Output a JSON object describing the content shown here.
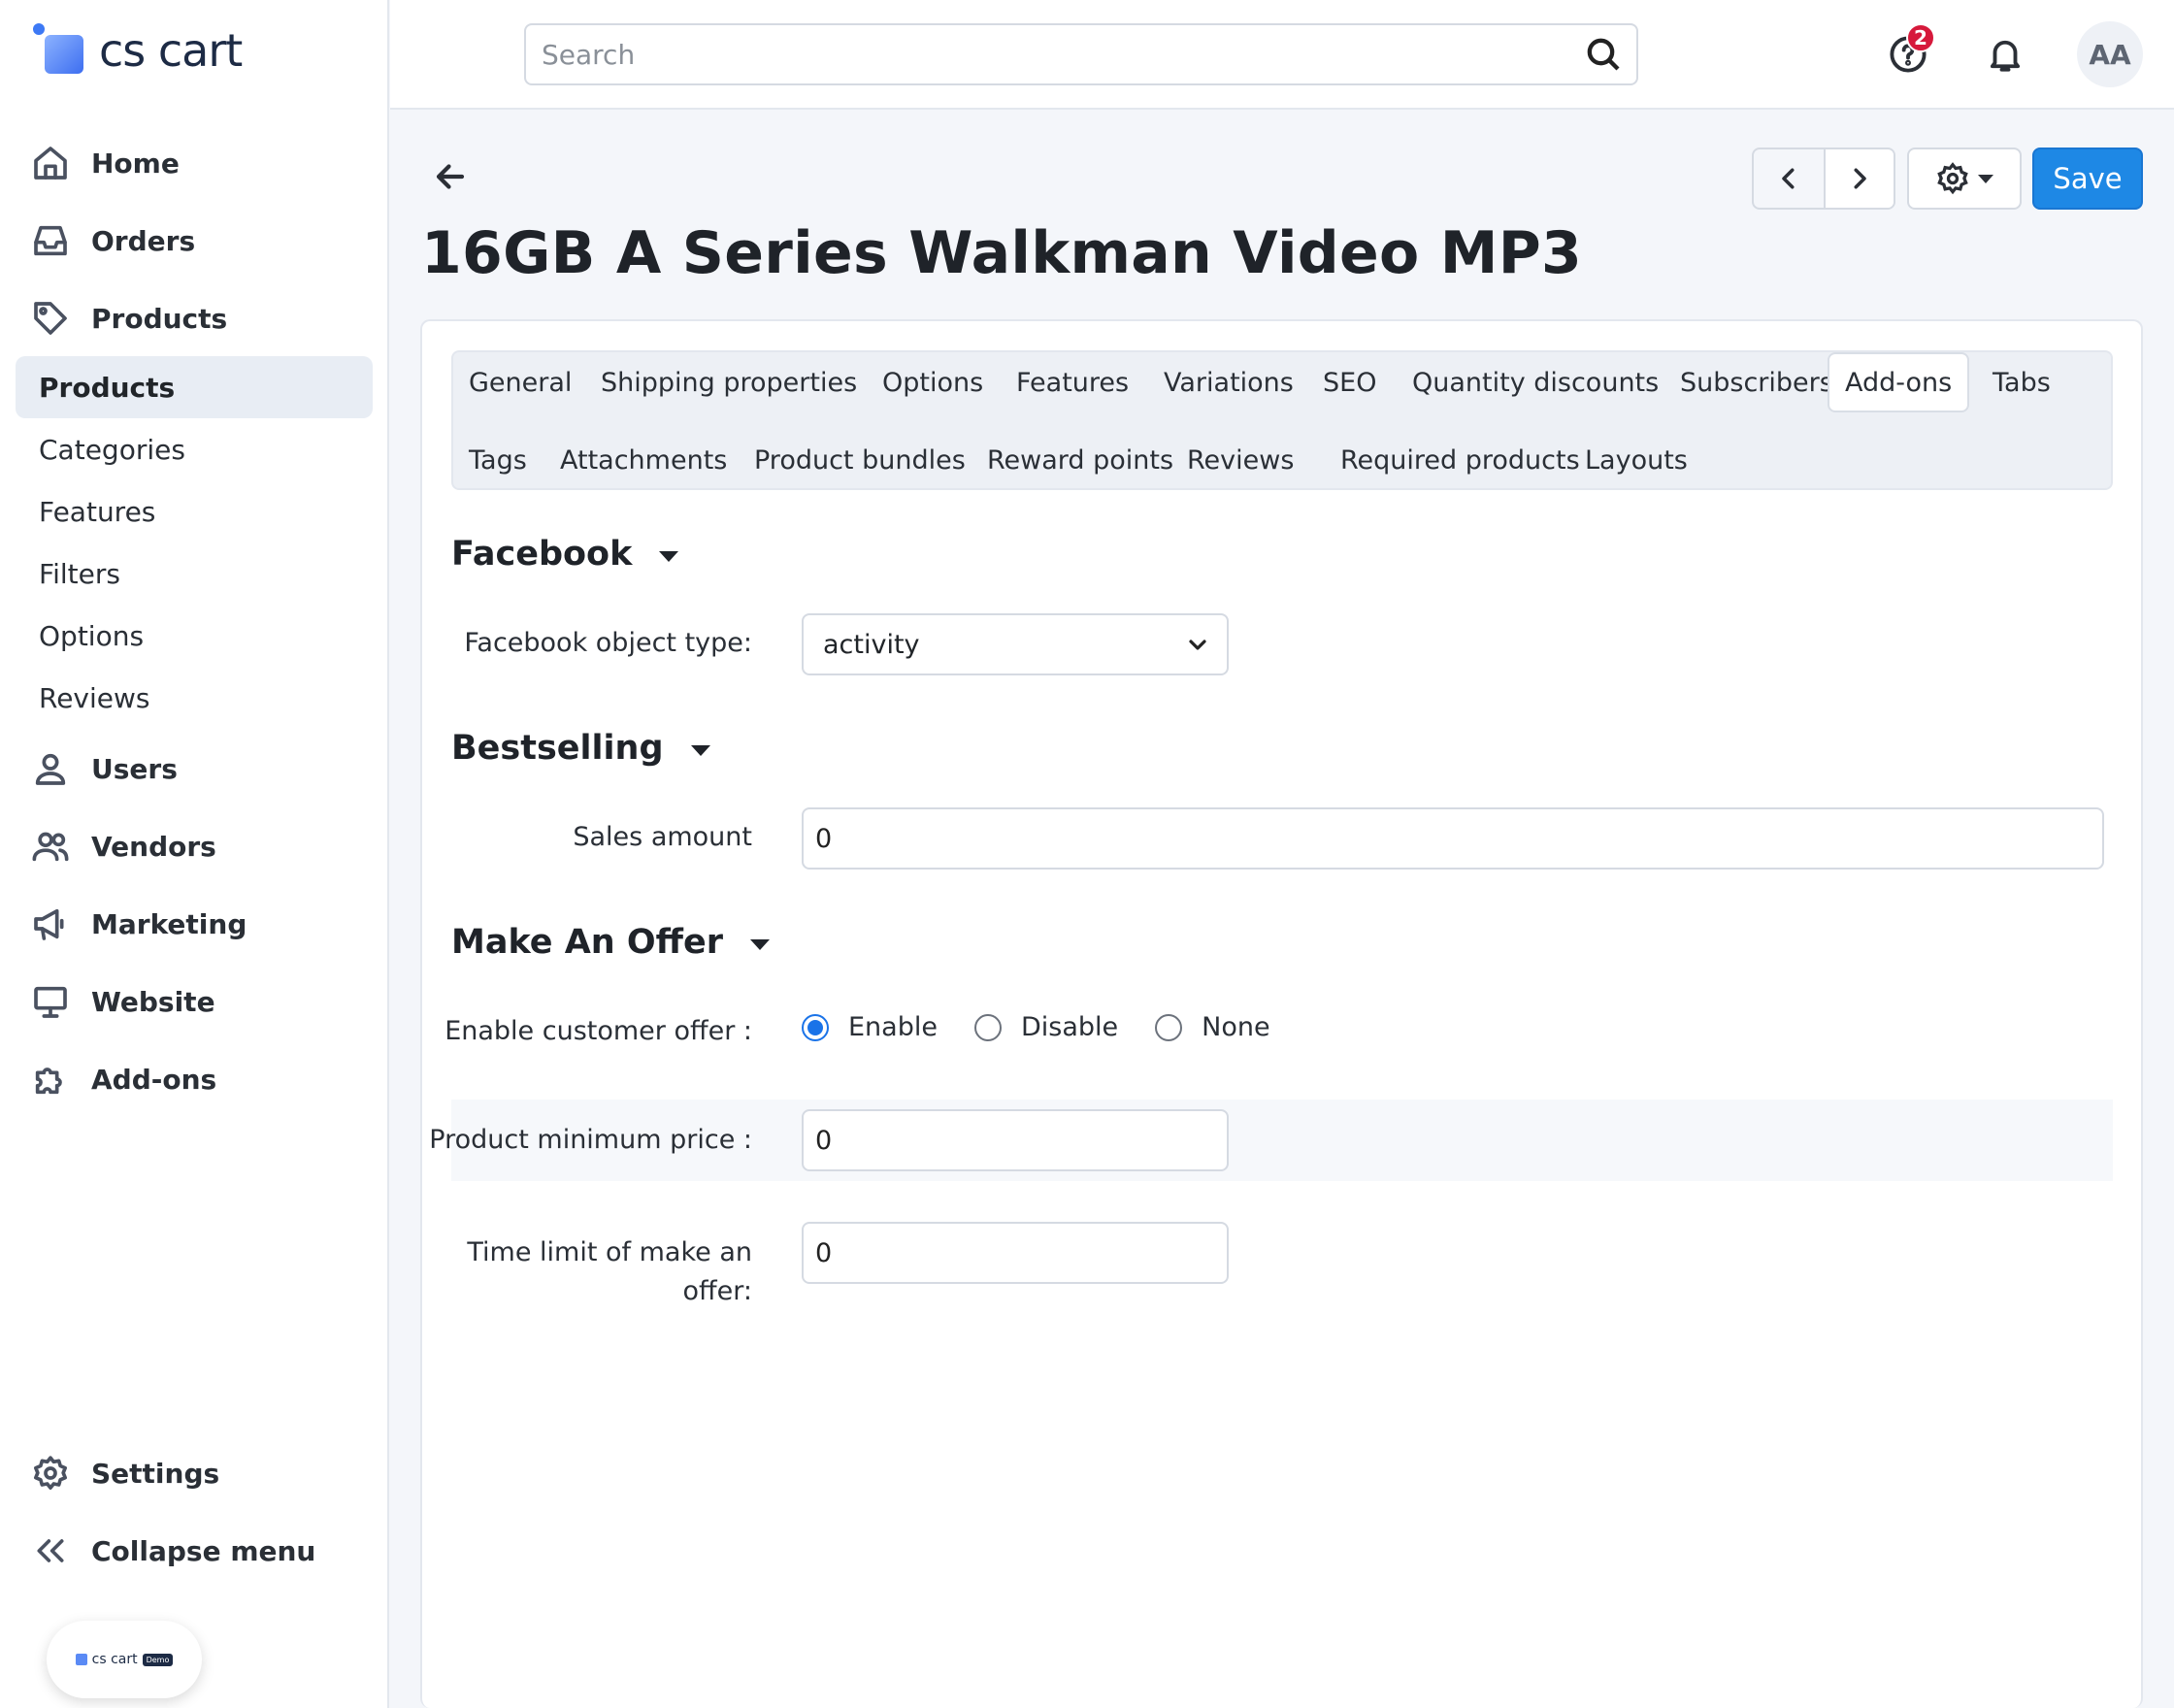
{
  "app": {
    "logo_text": "cs cart",
    "demo_badge_text": "cs cart",
    "demo_badge_tag": "Demo"
  },
  "sidebar": {
    "nav": [
      {
        "label": "Home",
        "icon": "home-icon"
      },
      {
        "label": "Orders",
        "icon": "inbox-icon"
      },
      {
        "label": "Products",
        "icon": "tag-icon"
      }
    ],
    "sub_items": [
      "Products",
      "Categories",
      "Features",
      "Filters",
      "Options",
      "Reviews"
    ],
    "nav2": [
      {
        "label": "Users",
        "icon": "user-icon"
      },
      {
        "label": "Vendors",
        "icon": "users-icon"
      },
      {
        "label": "Marketing",
        "icon": "megaphone-icon"
      },
      {
        "label": "Website",
        "icon": "monitor-icon"
      },
      {
        "label": "Add-ons",
        "icon": "puzzle-icon"
      }
    ],
    "settings_label": "Settings",
    "collapse_label": "Collapse menu"
  },
  "topbar": {
    "search_placeholder": "Search",
    "help_badge_count": "2",
    "avatar_initials": "AA"
  },
  "header": {
    "title": "16GB A Series Walkman Video MP3",
    "save_label": "Save"
  },
  "tabs": {
    "row1": [
      "General",
      "Shipping properties",
      "Options",
      "Features",
      "Variations",
      "SEO",
      "Quantity discounts",
      "Subscribers",
      "Add-ons",
      "Tabs"
    ],
    "row2": [
      "Tags",
      "Attachments",
      "Product bundles",
      "Reward points",
      "Reviews",
      "Required products",
      "Layouts"
    ],
    "active": "Add-ons"
  },
  "facebook": {
    "heading": "Facebook",
    "object_type_label": "Facebook object type:",
    "object_type_value": "activity"
  },
  "bestselling": {
    "heading": "Bestselling",
    "sales_amount_label": "Sales amount",
    "sales_amount_value": "0"
  },
  "make_an_offer": {
    "heading": "Make An Offer",
    "enable_label": "Enable customer offer :",
    "options": [
      "Enable",
      "Disable",
      "None"
    ],
    "selected": "Enable",
    "min_price_label": "Product minimum price :",
    "min_price_value": "0",
    "time_limit_label": "Time limit of make an offer:",
    "time_limit_value": "0"
  },
  "colors": {
    "accent": "#1e88e5",
    "badge": "#d6193b",
    "sidebar_active_bg": "#e8edf4"
  }
}
